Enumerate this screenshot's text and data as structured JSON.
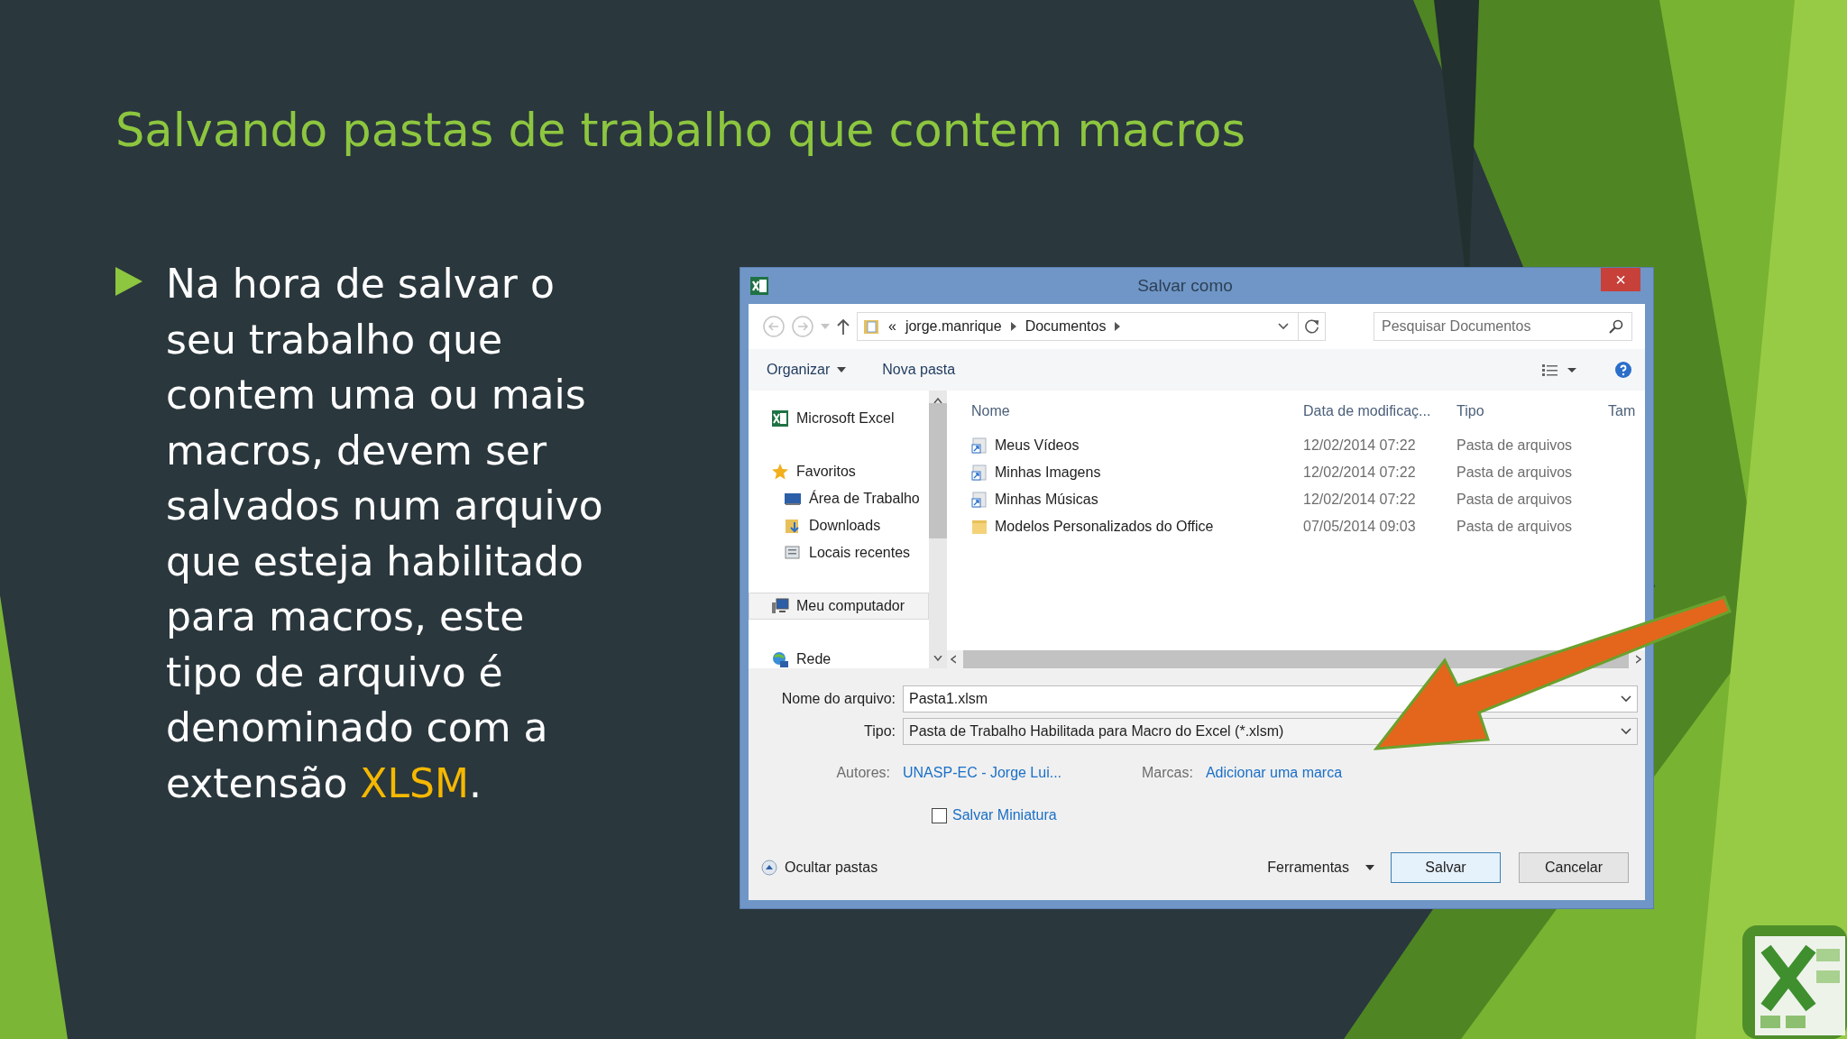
{
  "slide": {
    "title": "Salvando pastas de trabalho que contem macros",
    "bullet": {
      "text": "Na hora de salvar o seu trabalho que contem uma ou mais macros, devem ser salvados num arquivo que esteja habilitado para macros, este tipo de arquivo é denominado com a extensão",
      "highlight": "XLSM",
      "end": "."
    }
  },
  "dialog": {
    "title": "Salvar como",
    "close": "×",
    "address": {
      "prefix": "«",
      "crumbs": [
        "jorge.manrique",
        "Documentos"
      ]
    },
    "search": {
      "placeholder": "Pesquisar Documentos"
    },
    "toolbar": [
      "Organizar",
      "Nova pasta"
    ],
    "nav": [
      {
        "label": "Microsoft Excel",
        "kind": "excel",
        "selected": false
      },
      {
        "label": "Favoritos",
        "kind": "star",
        "selected": false,
        "children": [
          {
            "label": "Área de Trabalho",
            "kind": "desktop",
            "selected": false
          },
          {
            "label": "Downloads",
            "kind": "downloads",
            "selected": false
          },
          {
            "label": "Locais recentes",
            "kind": "recent",
            "selected": false
          }
        ]
      },
      {
        "label": "Meu computador",
        "kind": "computer",
        "selected": true
      },
      {
        "label": "Rede",
        "kind": "network",
        "selected": false
      }
    ],
    "columns": [
      "Nome",
      "Data de modificaç...",
      "Tipo",
      "Tam"
    ],
    "rows": [
      {
        "name": "Meus Vídeos",
        "date": "12/02/2014 07:22",
        "type": "Pasta de arquivos",
        "kind": "shortcut"
      },
      {
        "name": "Minhas Imagens",
        "date": "12/02/2014 07:22",
        "type": "Pasta de arquivos",
        "kind": "shortcut"
      },
      {
        "name": "Minhas Músicas",
        "date": "12/02/2014 07:22",
        "type": "Pasta de arquivos",
        "kind": "shortcut"
      },
      {
        "name": "Modelos Personalizados do Office",
        "date": "07/05/2014 09:03",
        "type": "Pasta de arquivos",
        "kind": "folder"
      }
    ],
    "filename": {
      "label": "Nome do arquivo:",
      "value": "Pasta1.xlsm"
    },
    "filetype": {
      "label": "Tipo:",
      "value": "Pasta de Trabalho Habilitada para Macro do Excel (*.xlsm)"
    },
    "authors": {
      "label": "Autores:",
      "value": "UNASP-EC - Jorge Lui..."
    },
    "tags": {
      "label": "Marcas:",
      "value": "Adicionar uma marca"
    },
    "thumbnail": {
      "label": "Salvar Miniatura",
      "checked": false
    },
    "hide_folders": "Ocultar pastas",
    "tools": "Ferramentas",
    "buttons": [
      "Salvar",
      "Cancelar"
    ]
  }
}
